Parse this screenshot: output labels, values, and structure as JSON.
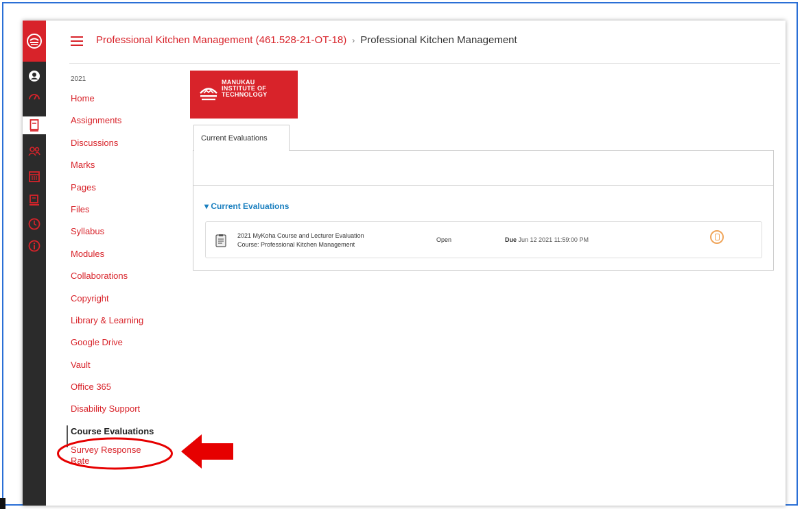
{
  "breadcrumb": {
    "course_link": "Professional Kitchen Management (461.528-21-OT-18)",
    "separator": "›",
    "current": "Professional Kitchen Management"
  },
  "course_nav": {
    "term": "2021",
    "items": [
      {
        "label": "Home"
      },
      {
        "label": "Assignments"
      },
      {
        "label": "Discussions"
      },
      {
        "label": "Marks"
      },
      {
        "label": "Pages"
      },
      {
        "label": "Files"
      },
      {
        "label": "Syllabus"
      },
      {
        "label": "Modules"
      },
      {
        "label": "Collaborations"
      },
      {
        "label": "Copyright"
      },
      {
        "label": "Library & Learning"
      },
      {
        "label": "Google Drive"
      },
      {
        "label": "Vault"
      },
      {
        "label": "Office 365"
      },
      {
        "label": "Disability Support"
      },
      {
        "label": "Course Evaluations"
      },
      {
        "label": "Survey Response Rate"
      }
    ],
    "active_item": "Course Evaluations"
  },
  "global_nav": {
    "icons": [
      "logo-icon",
      "account-icon",
      "dashboard-icon",
      "courses-icon",
      "groups-icon",
      "calendar-icon",
      "inbox-icon",
      "history-icon",
      "help-icon"
    ]
  },
  "brand": {
    "line1": "MANUKAU",
    "line2": "INSTITUTE OF",
    "line3": "TECHNOLOGY"
  },
  "tabs": [
    {
      "label": "Current Evaluations"
    }
  ],
  "evaluations": {
    "section_title": "▾ Current Evaluations",
    "rows": [
      {
        "title": "2021 MyKoha Course and Lecturer Evaluation",
        "course": "Course: Professional Kitchen Management",
        "status": "Open",
        "due_label": "Due",
        "due_date": "Jun 12 2021 11:59:00 PM"
      }
    ]
  },
  "colors": {
    "brand_red": "#d8232a",
    "nav_dark": "#2b2b2b",
    "link_blue": "#1a7fbf",
    "annotation_red": "#e60000",
    "frame_blue": "#2a6fd6"
  }
}
